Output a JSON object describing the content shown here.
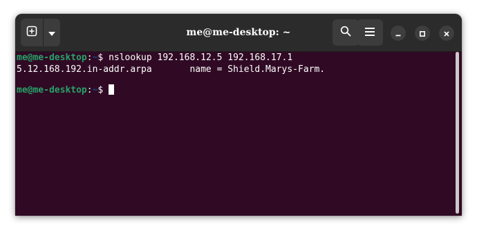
{
  "window": {
    "title": "me@me-desktop: ~"
  },
  "headerbar": {
    "new_tab_icon": "plus-square-icon",
    "dropdown_icon": "chevron-down-icon",
    "search_icon": "search-icon",
    "menu_icon": "hamburger-menu-icon",
    "minimize_icon": "minimize-icon",
    "maximize_icon": "maximize-icon",
    "close_icon": "close-icon"
  },
  "terminal": {
    "lines": [
      {
        "prompt_user": "me@me-desktop",
        "prompt_sep": ":",
        "prompt_path": "~",
        "prompt_symbol": "$ ",
        "command": "nslookup 192.168.12.5 192.168.17.1"
      },
      {
        "output": "5.12.168.192.in-addr.arpa       name = Shield.Marys-Farm."
      },
      {
        "prompt_user": "me@me-desktop",
        "prompt_sep": ":",
        "prompt_path": "~",
        "prompt_symbol": "$ ",
        "command": ""
      }
    ]
  },
  "colors": {
    "terminal_bg": "#300a24",
    "headerbar_bg": "#2b2b2b",
    "prompt_user": "#26a269",
    "prompt_path": "#12488b",
    "text": "#ffffff"
  }
}
